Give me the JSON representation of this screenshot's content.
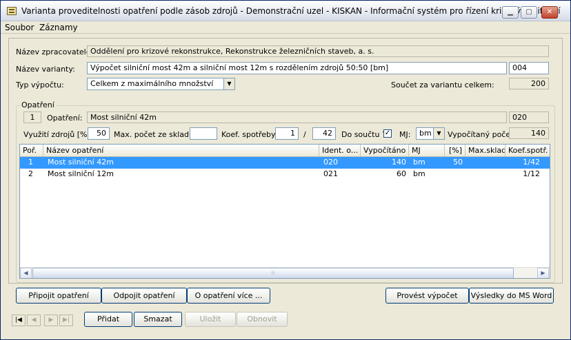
{
  "window": {
    "title": "Varianta proveditelnosti opatření podle zásob zdrojů - Demonstrační uzel - KISKAN - Informační systém pro řízení krizových situací",
    "min_label": "▁",
    "max_label": "▢",
    "close_label": "✕"
  },
  "menu": {
    "items": [
      "Soubor",
      "Záznamy"
    ]
  },
  "form": {
    "processor_label": "Název zpracovatele:",
    "processor_value": "Oddělení pro krizové rekonstrukce, Rekonstrukce železničních staveb, a. s.",
    "variant_label": "Název varianty:",
    "variant_value": "Výpočet silniční most 42m a silniční most 12m s rozdělením zdrojů 50:50 [bm]",
    "variant_code": "004",
    "calc_type_label": "Typ výpočtu:",
    "calc_type_value": "Celkem z maximálního množství",
    "total_label": "Součet za variantu celkem:",
    "total_value": "200"
  },
  "measure": {
    "group_title": "Opatření",
    "index": "1",
    "measure_label": "Opatření:",
    "measure_value": "Most silniční 42m",
    "measure_code": "020",
    "usage_label": "Využití zdrojů [%]:",
    "usage_value": "50",
    "max_stock_label": "Max. počet ze skladu:",
    "max_stock_value": "",
    "coef_label": "Koef. spotřeby:",
    "coef_num": "1",
    "coef_sep": "/",
    "coef_den": "42",
    "sum_label": "Do součtu ?",
    "sum_checked": "✓",
    "mj_label": "MJ:",
    "mj_value": "bm",
    "computed_label": "Vypočítaný počet:",
    "computed_value": "140"
  },
  "grid": {
    "columns": [
      "Poř.",
      "Název opatření",
      "Ident. o...",
      "Vypočítáno",
      "MJ",
      "[%]",
      "Max.sklad",
      "Koef.spotř."
    ],
    "rows": [
      {
        "por": "1",
        "name": "Most silniční 42m",
        "ident": "020",
        "calc": "140",
        "mj": "bm",
        "pct": "50",
        "max": "",
        "coef": "1/42"
      },
      {
        "por": "2",
        "name": "Most silniční 12m",
        "ident": "021",
        "calc": "60",
        "mj": "bm",
        "pct": "",
        "max": "",
        "coef": "1/12"
      }
    ],
    "scroll_left": "◀",
    "scroll_right": "▶",
    "scroll_grip": "⦙⦙⦙"
  },
  "actions": {
    "attach": "Připojit opatření",
    "detach": "Odpojit opatření",
    "more": "O opatření více ...",
    "compute": "Provést výpočet",
    "export": "Výsledky do MS Word"
  },
  "nav": {
    "first": "|◀",
    "prev": "◀",
    "next": "▶",
    "last": "▶|",
    "add": "Přidat",
    "delete": "Smazat",
    "save": "Uložit",
    "refresh": "Obnovit"
  }
}
